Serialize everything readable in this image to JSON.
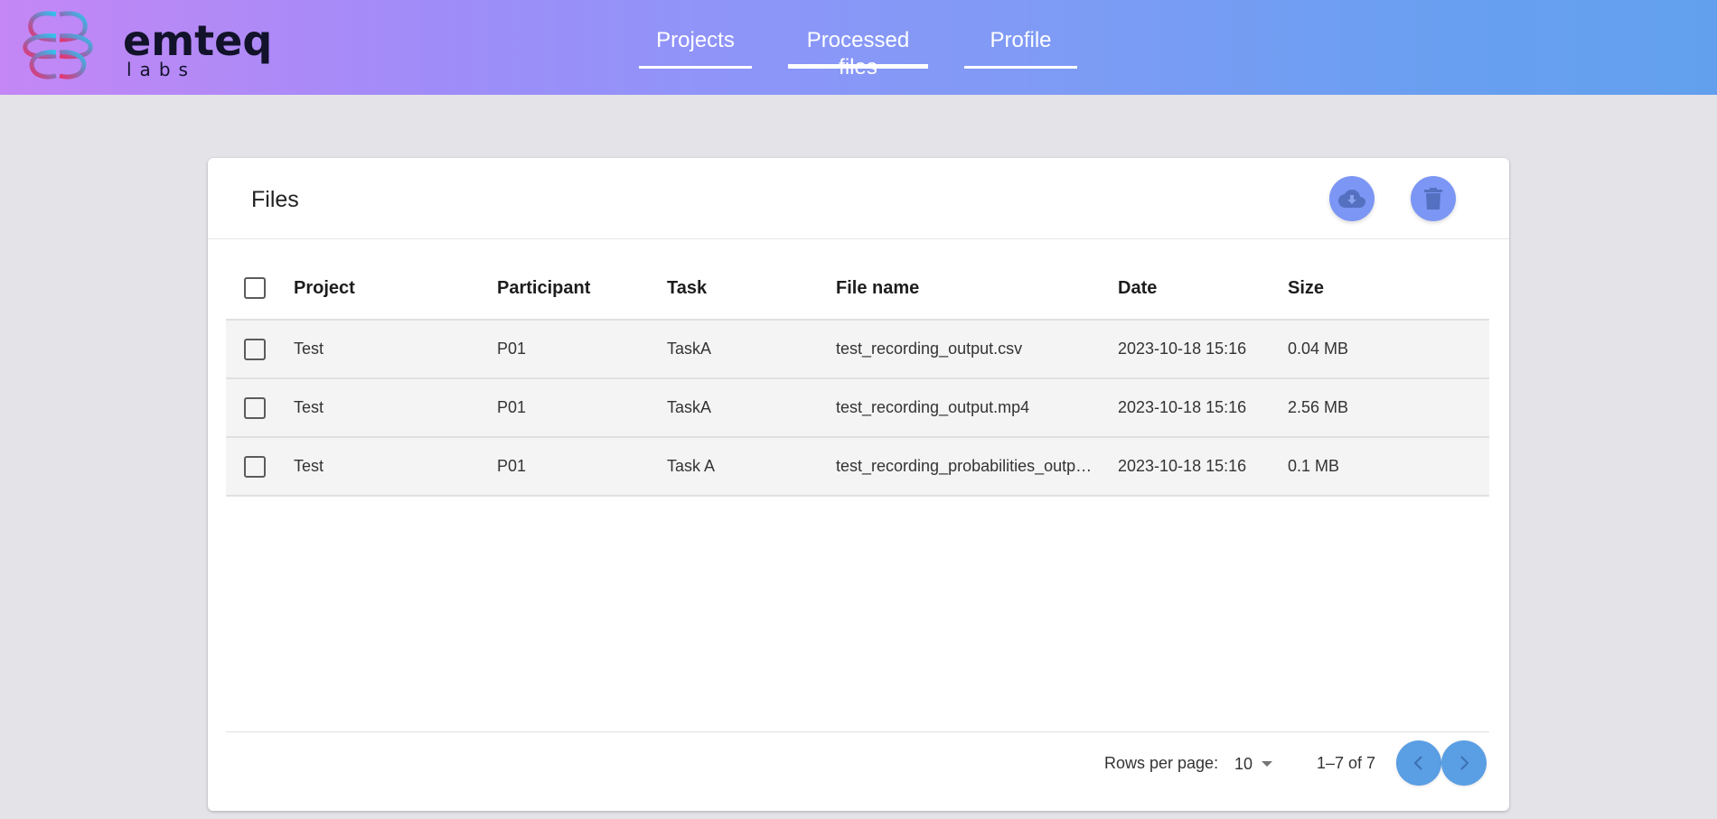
{
  "brand": {
    "name": "emteq",
    "sub": "labs",
    "gradient_colors": [
      "#c487f5",
      "#8c96f8",
      "#62a0ee"
    ]
  },
  "nav": {
    "items": [
      {
        "label": "Projects",
        "active": false
      },
      {
        "label": "Processed files",
        "active": true
      },
      {
        "label": "Profile",
        "active": false
      }
    ]
  },
  "files_card": {
    "title": "Files",
    "actions": [
      {
        "name": "download",
        "icon": "cloud-download-icon"
      },
      {
        "name": "delete",
        "icon": "trash-icon"
      }
    ],
    "accent": "#7b96f4"
  },
  "table": {
    "columns": [
      "Project",
      "Participant",
      "Task",
      "File name",
      "Date",
      "Size"
    ],
    "rows": [
      {
        "project": "Test",
        "participant": "P01",
        "task": "TaskA",
        "file_name": "test_recording_output.csv",
        "date": "2023-10-18 15:16",
        "size": "0.04 MB",
        "selected": false
      },
      {
        "project": "Test",
        "participant": "P01",
        "task": "TaskA",
        "file_name": "test_recording_output.mp4",
        "date": "2023-10-18 15:16",
        "size": "2.56 MB",
        "selected": false
      },
      {
        "project": "Test",
        "participant": "P01",
        "task": "Task A",
        "file_name": "test_recording_probabilities_outp…",
        "date": "2023-10-18 15:16",
        "size": "0.1 MB",
        "selected": false
      }
    ]
  },
  "pagination": {
    "rows_per_page_label": "Rows per page:",
    "rows_per_page_value": "10",
    "range_label": "1–7 of 7",
    "prev_icon": "chevron-left-icon",
    "next_icon": "chevron-right-icon",
    "button_color": "#5a9ee4"
  }
}
